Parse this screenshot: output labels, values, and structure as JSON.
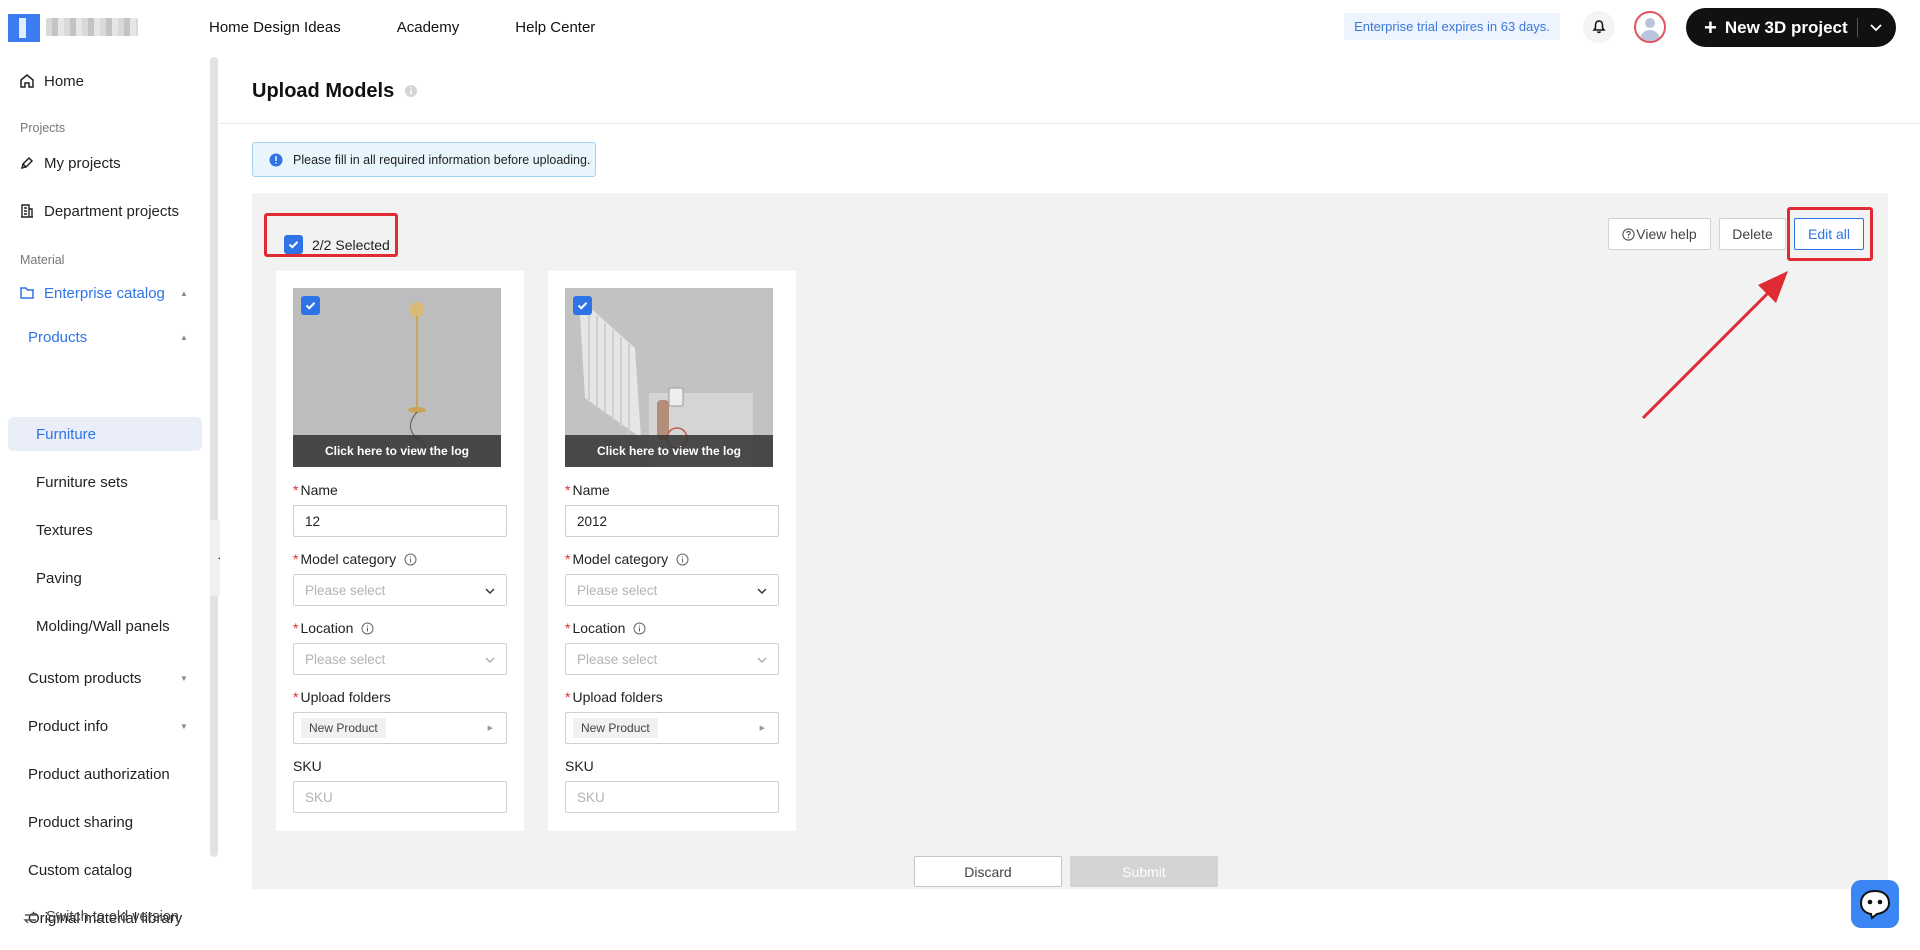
{
  "topbar": {
    "nav": [
      "Home Design Ideas",
      "Academy",
      "Help Center"
    ],
    "trial_text": "Enterprise trial expires in 63 days.",
    "new_project_label": "New 3D project"
  },
  "sidebar": {
    "home": "Home",
    "section_projects": "Projects",
    "my_projects": "My projects",
    "department_projects": "Department projects",
    "section_material": "Material",
    "enterprise_catalog": "Enterprise catalog",
    "products": "Products",
    "furniture": "Furniture",
    "furniture_sets": "Furniture sets",
    "textures": "Textures",
    "paving": "Paving",
    "molding": "Molding/Wall panels",
    "custom_products": "Custom products",
    "product_info": "Product info",
    "product_authorization": "Product authorization",
    "product_sharing": "Product sharing",
    "custom_catalog": "Custom catalog",
    "original_material_library": "Original material library",
    "switch_old": "Switch to old version"
  },
  "main": {
    "title": "Upload Models",
    "alert": "Please fill in all required information before uploading.",
    "selected_text": "2/2 Selected",
    "view_help": "View help",
    "delete": "Delete",
    "edit_all": "Edit all",
    "discard": "Discard",
    "submit": "Submit"
  },
  "cards": [
    {
      "log_text": "Click here to view the log",
      "name_label": "Name",
      "name_value": "12",
      "category_label": "Model category",
      "category_placeholder": "Please select",
      "location_label": "Location",
      "location_placeholder": "Please select",
      "folders_label": "Upload folders",
      "folder_tag": "New Product",
      "sku_label": "SKU",
      "sku_placeholder": "SKU"
    },
    {
      "log_text": "Click here to view the log",
      "name_label": "Name",
      "name_value": "2012",
      "category_label": "Model category",
      "category_placeholder": "Please select",
      "location_label": "Location",
      "location_placeholder": "Please select",
      "folders_label": "Upload folders",
      "folder_tag": "New Product",
      "sku_label": "SKU",
      "sku_placeholder": "SKU"
    }
  ],
  "colors": {
    "accent": "#2f74e6",
    "highlight": "#e02b35",
    "panel_bg": "#f2f2f2"
  }
}
